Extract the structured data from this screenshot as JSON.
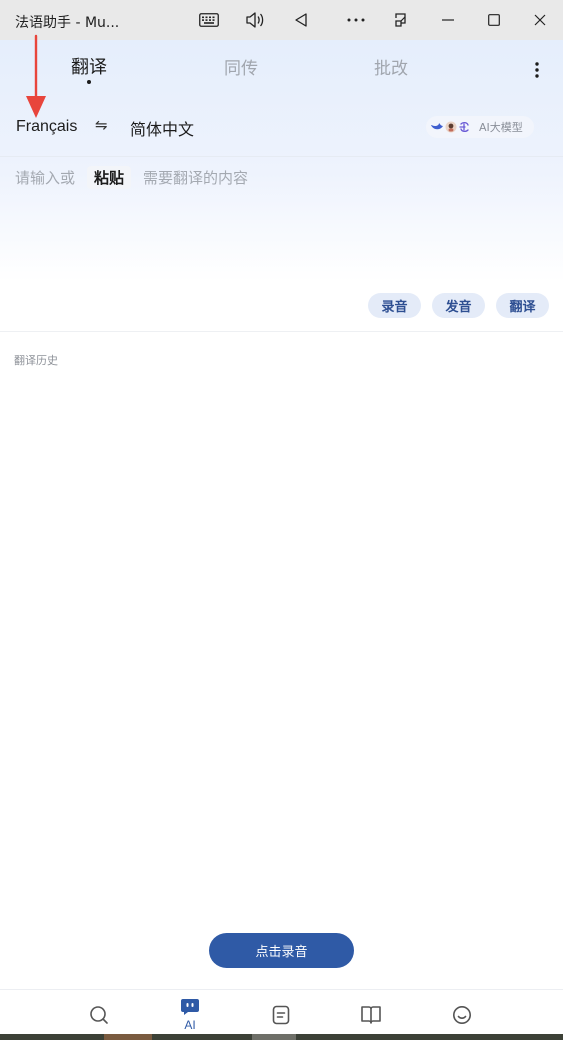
{
  "window": {
    "title": "法语助手 - Mu...",
    "controls": [
      "keyboard-icon",
      "speaker-icon",
      "back-icon",
      "more-icon",
      "resize-icon",
      "minimize-icon",
      "maximize-icon",
      "close-icon"
    ]
  },
  "tabs": [
    {
      "label": "翻译",
      "active": true
    },
    {
      "label": "同传",
      "active": false
    },
    {
      "label": "批改",
      "active": false
    }
  ],
  "languages": {
    "source": "Français",
    "swap_symbol": "⇋",
    "target": "简体中文"
  },
  "model": {
    "label": "AI大模型"
  },
  "input": {
    "prefix": "请输入或",
    "paste_label": "粘贴",
    "suffix": "需要翻译的内容"
  },
  "actions": {
    "record": "录音",
    "speak": "发音",
    "translate": "翻译"
  },
  "history": {
    "label": "翻译历史"
  },
  "cta": {
    "label": "点击录音"
  },
  "bottom_nav": {
    "items": [
      {
        "icon": "search-icon",
        "label": ""
      },
      {
        "icon": "ai-icon",
        "label": "AI",
        "active": true
      },
      {
        "icon": "notes-icon",
        "label": ""
      },
      {
        "icon": "book-icon",
        "label": ""
      },
      {
        "icon": "smile-icon",
        "label": ""
      }
    ]
  },
  "colors": {
    "accent": "#2f5aa6",
    "annotation_arrow": "#e8453c"
  }
}
